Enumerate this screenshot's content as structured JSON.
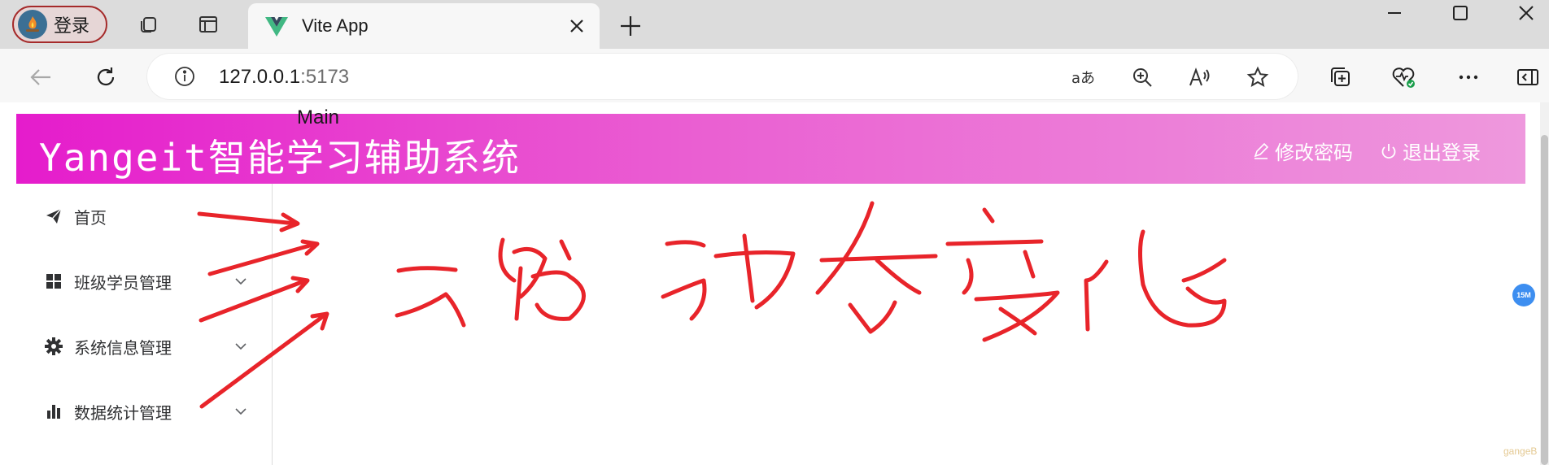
{
  "browser": {
    "profile_label": "登录",
    "tab_title": "Vite App",
    "address_host": "127.0.0.1",
    "address_port": ":5173"
  },
  "app": {
    "title": "Yangeit智能学习辅助系统",
    "change_password_label": "修改密码",
    "logout_label": "退出登录"
  },
  "sidebar": {
    "items": [
      {
        "label": "首页",
        "icon": "paper-plane-icon",
        "has_chevron": false
      },
      {
        "label": "班级学员管理",
        "icon": "grid-icon",
        "has_chevron": true
      },
      {
        "label": "系统信息管理",
        "icon": "gear-icon",
        "has_chevron": true
      },
      {
        "label": "数据统计管理",
        "icon": "bar-chart-icon",
        "has_chevron": true
      }
    ]
  },
  "main": {
    "text": "Main"
  },
  "extension_badge": "15M",
  "watermark": "gangeB",
  "colors": {
    "header_gradient_start": "#e51ccc",
    "header_gradient_end": "#ee98dd",
    "annotation_red": "#e8242a",
    "profile_border": "#a52a2a"
  }
}
